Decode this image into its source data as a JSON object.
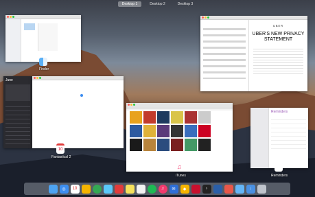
{
  "spaces": {
    "items": [
      "Desktop 1",
      "Desktop 2",
      "Desktop 3"
    ],
    "active": 0
  },
  "windows": {
    "finder": {
      "label": "Finder"
    },
    "fantastical": {
      "label": "Fantastical 2",
      "month": "June",
      "day": "10"
    },
    "itunes": {
      "label": "iTunes"
    },
    "reminders": {
      "label": "Reminders",
      "list_title": "Reminders"
    },
    "uber": {
      "logo": "UBER",
      "headline": "UBER'S NEW PRIVACY STATEMENT"
    }
  },
  "dock": {
    "items": [
      "finder-icon",
      "safari-icon",
      "calendar-icon",
      "photos-icon",
      "chrome-icon",
      "messages-icon",
      "fantastical-icon",
      "notes-icon",
      "stickies-icon",
      "spotify-icon",
      "itunes-icon",
      "mail-icon",
      "sketch-icon",
      "acrobat-icon",
      "terminal-icon",
      "airmail-icon",
      "reeder-icon",
      "folder-icon",
      "downloads-icon",
      "trash-icon"
    ]
  }
}
